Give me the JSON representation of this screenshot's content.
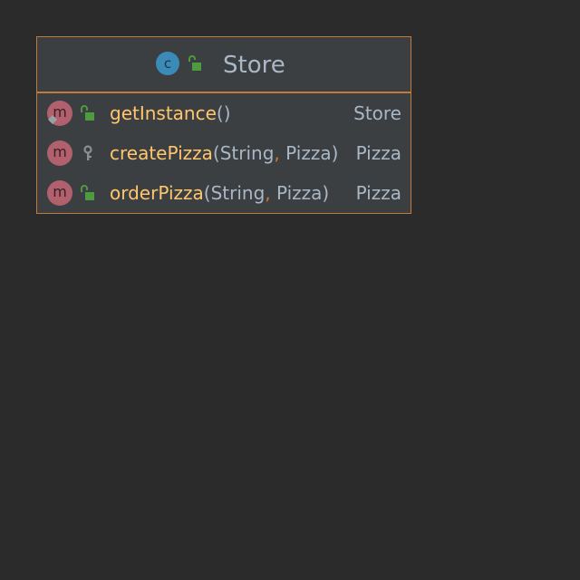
{
  "class": {
    "name": "Store",
    "kind_icon": "class-icon",
    "kind_letter": "c",
    "visibility_icon": "public-lock-icon"
  },
  "methods": [
    {
      "icon": "method-icon",
      "letter": "m",
      "static": true,
      "visibility": "public",
      "name": "getInstance",
      "params_open": "(",
      "param1": "",
      "comma": "",
      "param2": "",
      "params_close": ")",
      "return_type": "Store"
    },
    {
      "icon": "method-icon",
      "letter": "m",
      "static": false,
      "visibility": "package-private",
      "name": "createPizza",
      "params_open": "(",
      "param1": "String",
      "comma": ",",
      "param2": " Pizza",
      "params_close": ")",
      "return_type": "Pizza"
    },
    {
      "icon": "method-icon",
      "letter": "m",
      "static": false,
      "visibility": "public",
      "name": "orderPizza",
      "params_open": "(",
      "param1": "String",
      "comma": ",",
      "param2": " Pizza",
      "params_close": ")",
      "return_type": "Pizza"
    }
  ],
  "colors": {
    "background": "#2b2b2b",
    "box_fill": "#3c3f41",
    "box_border": "#c07a3a",
    "class_icon": "#3b8bb8",
    "method_icon": "#b1606d",
    "method_name": "#ffc66d",
    "text": "#a9b7c6",
    "lock_green": "#4e9a3f",
    "key_gray": "#8a8f93"
  }
}
